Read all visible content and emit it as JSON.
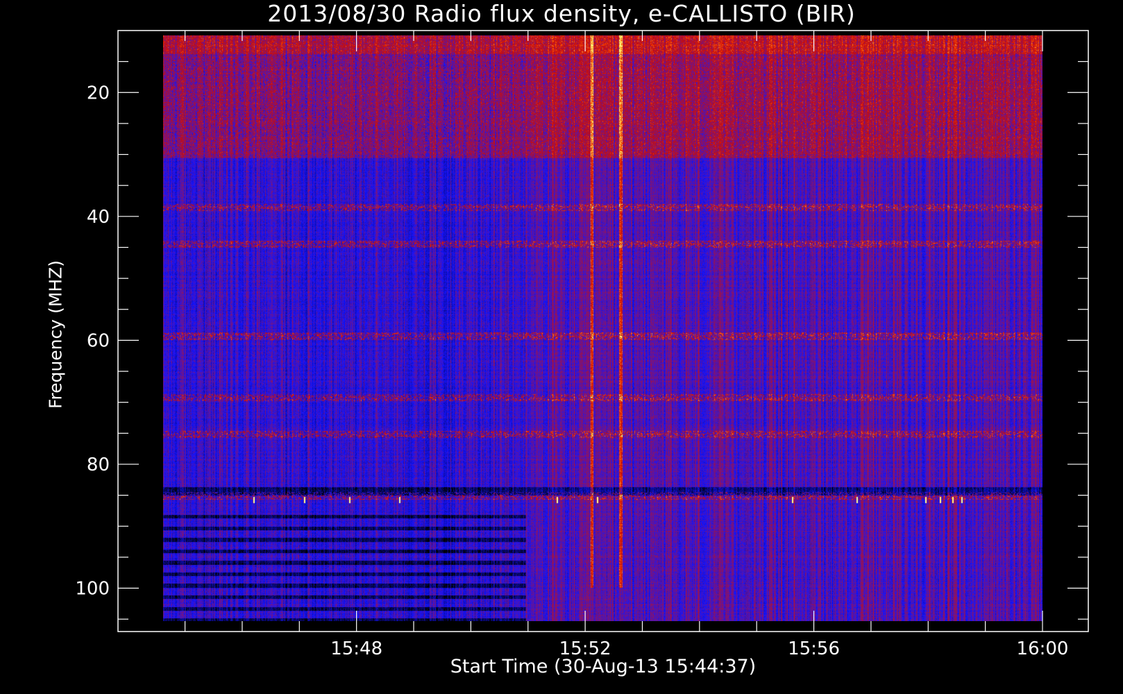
{
  "chart_data": {
    "type": "heatmap",
    "title": "2013/08/30  Radio flux density, e-CALLISTO (BIR)",
    "xlabel": "Start Time (30-Aug-13 15:44:37)",
    "ylabel": "Frequency (MHZ)",
    "x_range_seconds_after_start": [
      0,
      923
    ],
    "y_range_mhz": [
      10,
      107
    ],
    "y_axis_inverted": true,
    "data_x_range": [
      "15:44:37",
      "16:00:00"
    ],
    "data_y_range_mhz": [
      10,
      105.5
    ],
    "x_ticks": [
      {
        "label": "15:48",
        "seconds_after_start": 203
      },
      {
        "label": "15:52",
        "seconds_after_start": 443
      },
      {
        "label": "15:56",
        "seconds_after_start": 683
      },
      {
        "label": "16:00",
        "seconds_after_start": 923
      }
    ],
    "y_ticks": [
      20,
      40,
      60,
      80,
      100
    ],
    "colormap": [
      "#000000",
      "#0a0a8c",
      "#1414ff",
      "#8c1464",
      "#c80a0a",
      "#ff5000",
      "#ffff78"
    ],
    "grid": false,
    "bursts": [
      {
        "time": "15:52:07",
        "freq_mhz": [
          10,
          95
        ]
      },
      {
        "time": "15:52:37",
        "freq_mhz": [
          10,
          100
        ]
      }
    ],
    "interference_bands_mhz": [
      38,
      44,
      59,
      69,
      75,
      85
    ]
  }
}
